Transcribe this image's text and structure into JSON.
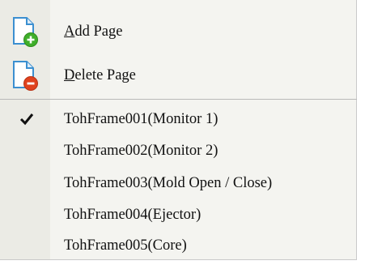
{
  "menu": {
    "actions": [
      {
        "mnemonic": "A",
        "rest": "dd Page",
        "icon": "add-page-icon"
      },
      {
        "mnemonic": "D",
        "rest": "elete Page",
        "icon": "delete-page-icon"
      }
    ],
    "pages": [
      {
        "label": "TohFrame001(Monitor 1)",
        "checked": true
      },
      {
        "label": "TohFrame002(Monitor 2)",
        "checked": false
      },
      {
        "label": "TohFrame003(Mold Open / Close)",
        "checked": false
      },
      {
        "label": "TohFrame004(Ejector)",
        "checked": false
      },
      {
        "label": "TohFrame005(Core)",
        "checked": false
      }
    ]
  },
  "colors": {
    "menu_bg": "#f4f4f0",
    "gutter_bg": "#ebebe5",
    "add_badge": "#3fae2a",
    "delete_badge": "#e0421e",
    "page_icon": "#3b8fd0"
  }
}
